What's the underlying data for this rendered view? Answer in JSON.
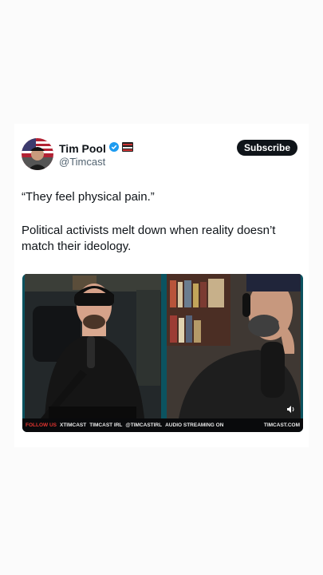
{
  "post": {
    "author_name": "Tim Pool",
    "handle": "@Timcast",
    "subscribe_label": "Subscribe",
    "quote": "“They feel physical pain.”",
    "body": "Political activists melt down when reality doesn’t match their ideology."
  },
  "icons": {
    "verified": "verified-badge-icon",
    "affiliate": "affiliate-badge-icon",
    "speaker": "speaker-icon"
  },
  "video": {
    "bar": {
      "follow": "FOLLOW US",
      "x": "XTIMCAST",
      "threads": "TIMCAST IRL",
      "ig": "@TIMCASTIRL",
      "audio": "AUDIO STREAMING ON",
      "site": "TIMCAST.COM"
    }
  },
  "colors": {
    "verified": "#1d9bf0",
    "follow": "#e2342f",
    "frame": "#0b5360"
  }
}
